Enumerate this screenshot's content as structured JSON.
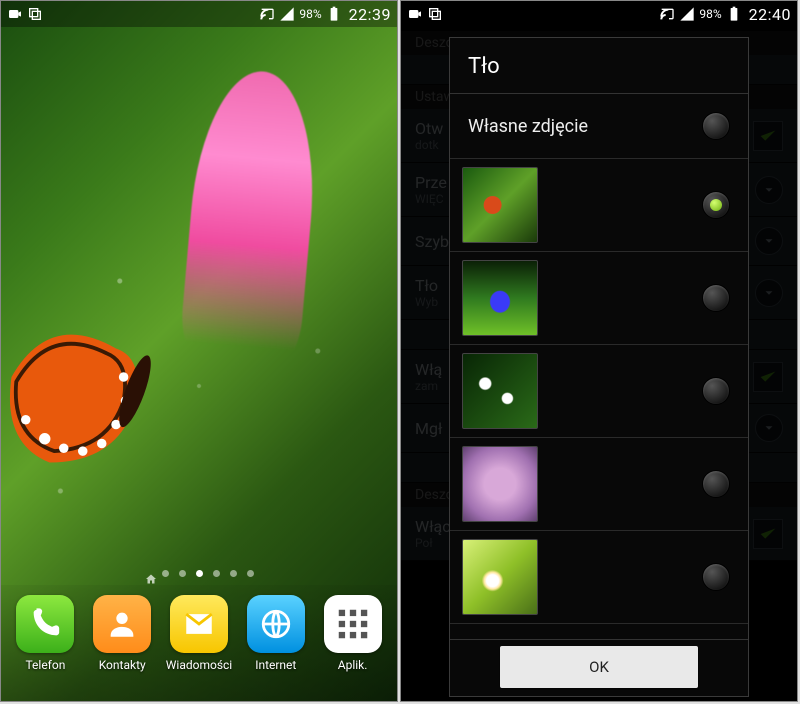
{
  "status": {
    "battery_pct": "98%",
    "time_left": "22:39",
    "time_right": "22:40"
  },
  "home": {
    "page_count": 7,
    "active_page_index": 3,
    "dock": [
      {
        "name": "phone",
        "label": "Telefon"
      },
      {
        "name": "contacts",
        "label": "Kontakty"
      },
      {
        "name": "messages",
        "label": "Wiadomości"
      },
      {
        "name": "browser",
        "label": "Internet"
      },
      {
        "name": "apps",
        "label": "Aplik."
      }
    ]
  },
  "settings_bg": {
    "header1": "Deszcz",
    "header2": "Ustawi",
    "row_open": "Otw",
    "row_open_sub": "dotk",
    "row_prze": "Prze",
    "row_wiec": "WIĘC",
    "row_szyb": "Szyb",
    "row_tlo": "Tło",
    "row_tlo_sub": "Wyb",
    "row_wla": "Włą",
    "row_wla_sub": "zam",
    "row_mgl": "Mgł",
    "header3": "Deszcz",
    "row_wlaczyc": "Włączyć /",
    "row_wlaczyc_sub": "Poł"
  },
  "dialog": {
    "title": "Tło",
    "custom_option": "Własne zdjęcie",
    "selected_index": 1,
    "ok": "OK"
  }
}
